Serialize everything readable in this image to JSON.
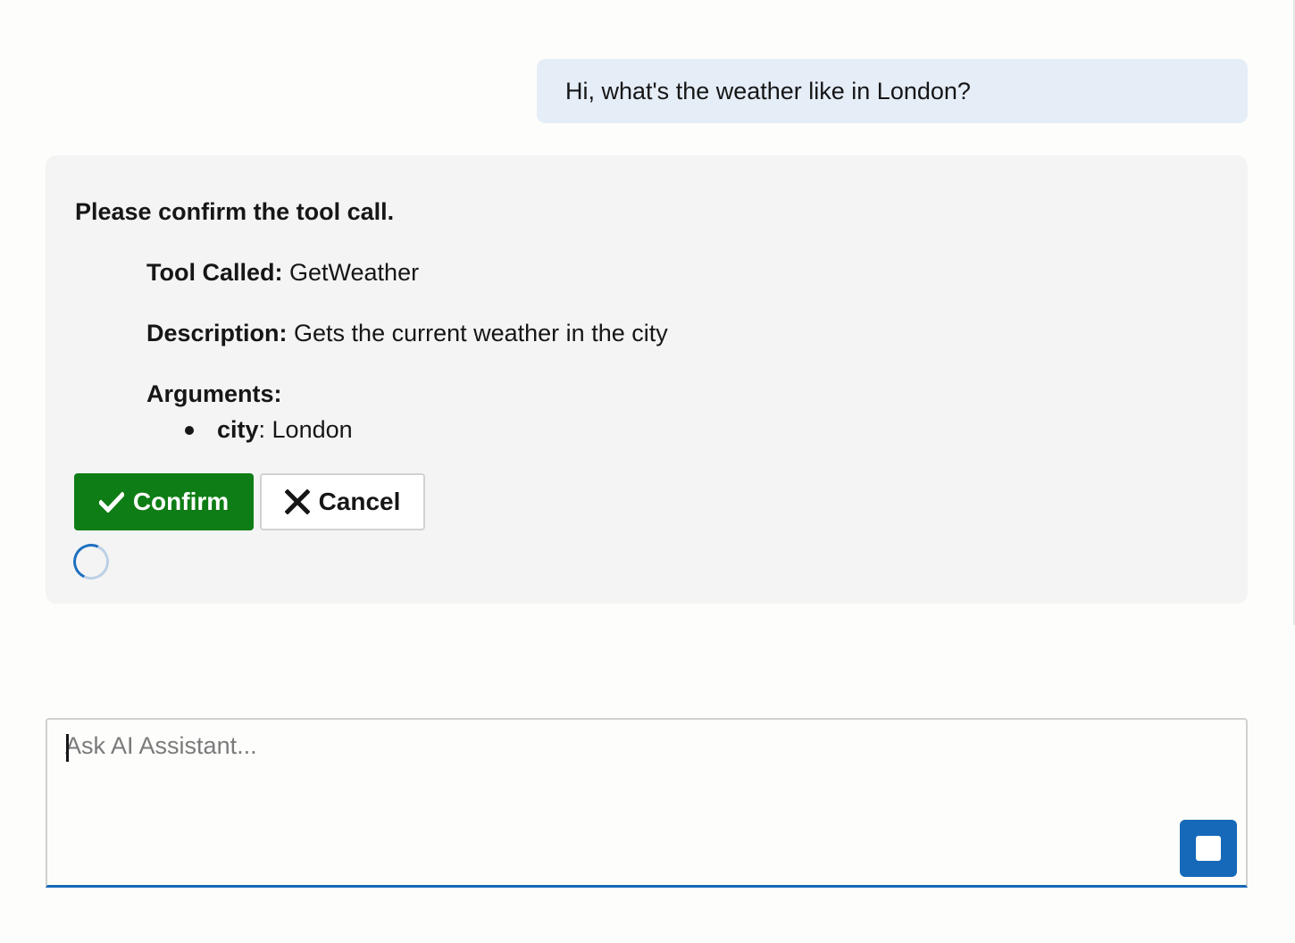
{
  "user_message": {
    "text": "Hi, what's the weather like in London?"
  },
  "tool_confirmation": {
    "heading": "Please confirm the tool call.",
    "tool_called_label": "Tool Called:",
    "tool_called_value": "GetWeather",
    "description_label": "Description:",
    "description_value": "Gets the current weather in the city",
    "arguments_label": "Arguments:",
    "arguments": [
      {
        "name": "city",
        "value": ": London"
      }
    ],
    "confirm_label": "Confirm",
    "cancel_label": "Cancel",
    "confirm_icon": "checkmark-icon",
    "cancel_icon": "close-icon",
    "status": "loading-spinner"
  },
  "chat_input": {
    "placeholder": "Ask AI Assistant...",
    "value": "",
    "stop_icon": "stop-icon"
  },
  "colors": {
    "user_bubble": "#e5edf7",
    "card_background": "#f4f4f4",
    "confirm_green": "#0f7d15",
    "accent_blue": "#1669b8"
  }
}
